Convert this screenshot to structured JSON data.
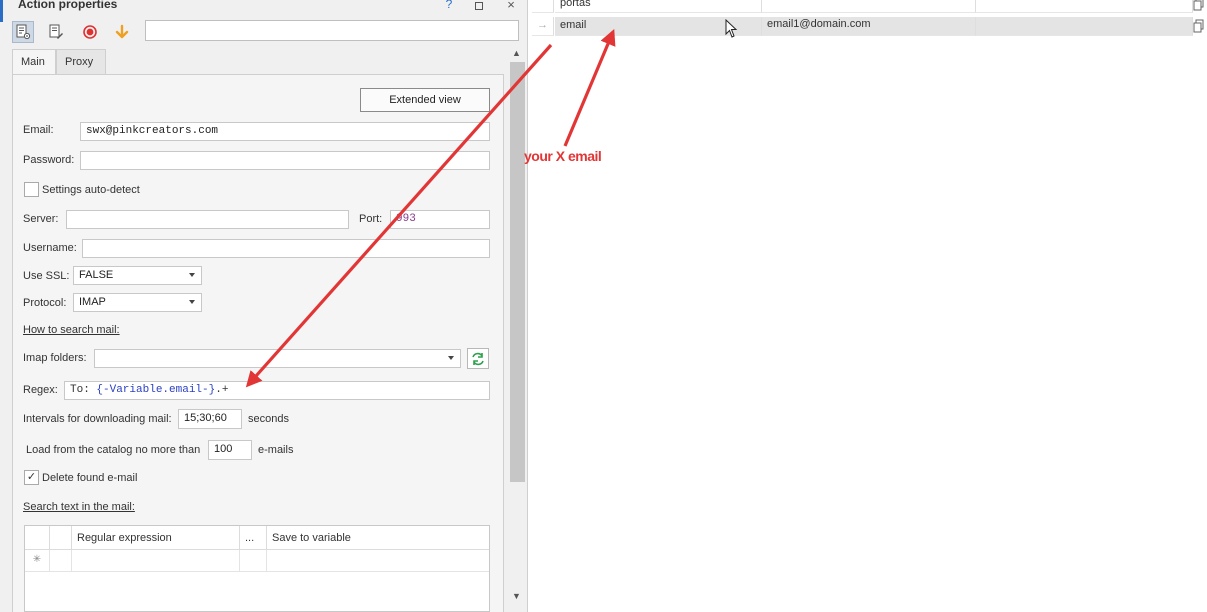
{
  "window": {
    "title": "Action properties",
    "help": "?",
    "restore_icon": "restore-icon",
    "close": "×"
  },
  "tabs": [
    {
      "label": "Main",
      "active": true
    },
    {
      "label": "Proxy",
      "active": false
    }
  ],
  "form": {
    "extended_view": "Extended view",
    "email_label": "Email:",
    "email_value": "swx@pinkcreators.com",
    "password_label": "Password:",
    "password_value": "",
    "autodetect_label": "Settings auto-detect",
    "server_label": "Server:",
    "server_value": "",
    "port_label": "Port:",
    "port_value": "993",
    "username_label": "Username:",
    "username_value": "",
    "ssl_label": "Use SSL:",
    "ssl_value": "FALSE",
    "protocol_label": "Protocol:",
    "protocol_value": "IMAP",
    "how_to_search": "How to search mail:",
    "imap_folders_label": "Imap folders:",
    "imap_folders_value": "",
    "regex_label": "Regex:",
    "regex_prefix": "To: ",
    "regex_variable": "{-Variable.email-}",
    "regex_suffix": ".+",
    "intervals_label": "Intervals for downloading mail:",
    "intervals_value": "15;30;60",
    "intervals_unit": "seconds",
    "load_label": "Load from the catalog no more than",
    "load_value": "100",
    "load_unit": "e-mails",
    "delete_found_label": "Delete found e-mail",
    "delete_found_checked": true,
    "search_text_label": "Search text in the mail:",
    "grid_headers": [
      "Regular expression",
      "...",
      "Save to variable"
    ],
    "new_row_marker": "✳"
  },
  "variables_table": {
    "rows": [
      {
        "name": "portas",
        "value": "",
        "selected": false
      },
      {
        "name": "email",
        "value": "email1@domain.com",
        "selected": true
      }
    ],
    "row_marker": "→"
  },
  "annotation": {
    "text": "your X email",
    "color": "#e23636"
  }
}
